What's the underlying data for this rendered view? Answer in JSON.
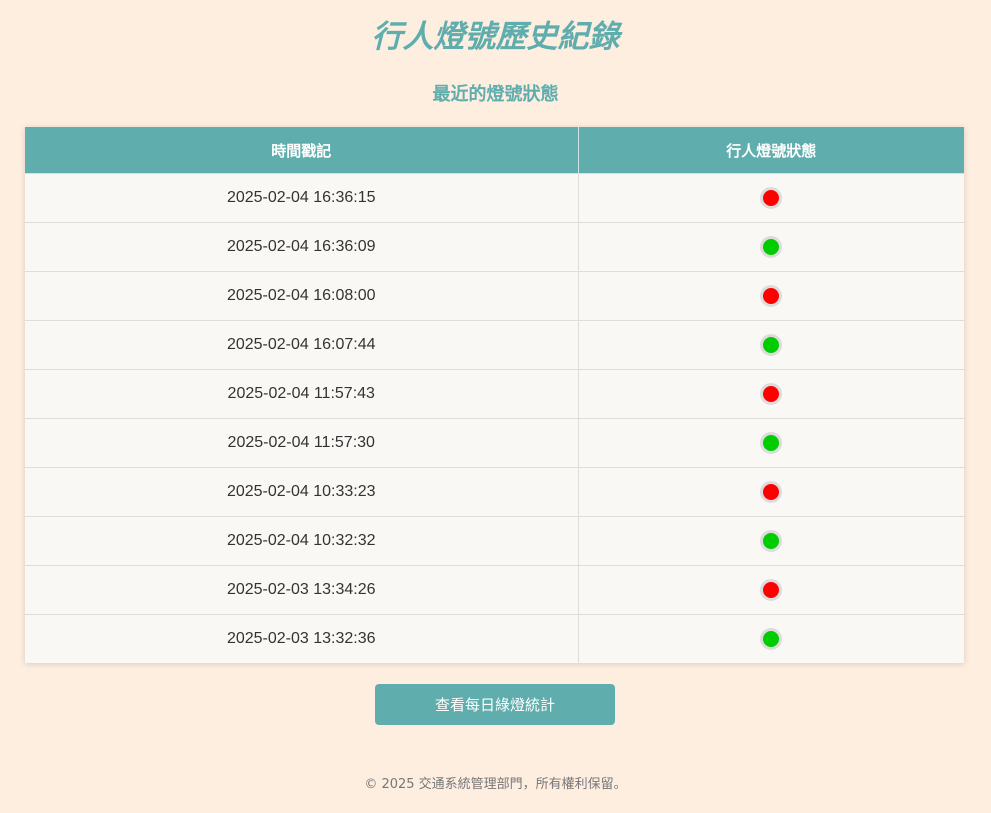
{
  "header": {
    "title": "行人燈號歷史紀錄",
    "subtitle": "最近的燈號狀態"
  },
  "table": {
    "columns": [
      "時間戳記",
      "行人燈號狀態"
    ],
    "rows": [
      {
        "timestamp": "2025-02-04 16:36:15",
        "status": "red"
      },
      {
        "timestamp": "2025-02-04 16:36:09",
        "status": "green"
      },
      {
        "timestamp": "2025-02-04 16:08:00",
        "status": "red"
      },
      {
        "timestamp": "2025-02-04 16:07:44",
        "status": "green"
      },
      {
        "timestamp": "2025-02-04 11:57:43",
        "status": "red"
      },
      {
        "timestamp": "2025-02-04 11:57:30",
        "status": "green"
      },
      {
        "timestamp": "2025-02-04 10:33:23",
        "status": "red"
      },
      {
        "timestamp": "2025-02-04 10:32:32",
        "status": "green"
      },
      {
        "timestamp": "2025-02-03 13:34:26",
        "status": "red"
      },
      {
        "timestamp": "2025-02-03 13:32:36",
        "status": "green"
      }
    ]
  },
  "status_colors": {
    "red": "#ff0000",
    "green": "#00cc00"
  },
  "stats_button": {
    "label": "查看每日綠燈統計"
  },
  "footer": {
    "text": "© 2025 交通系統管理部門，所有權利保留。"
  }
}
